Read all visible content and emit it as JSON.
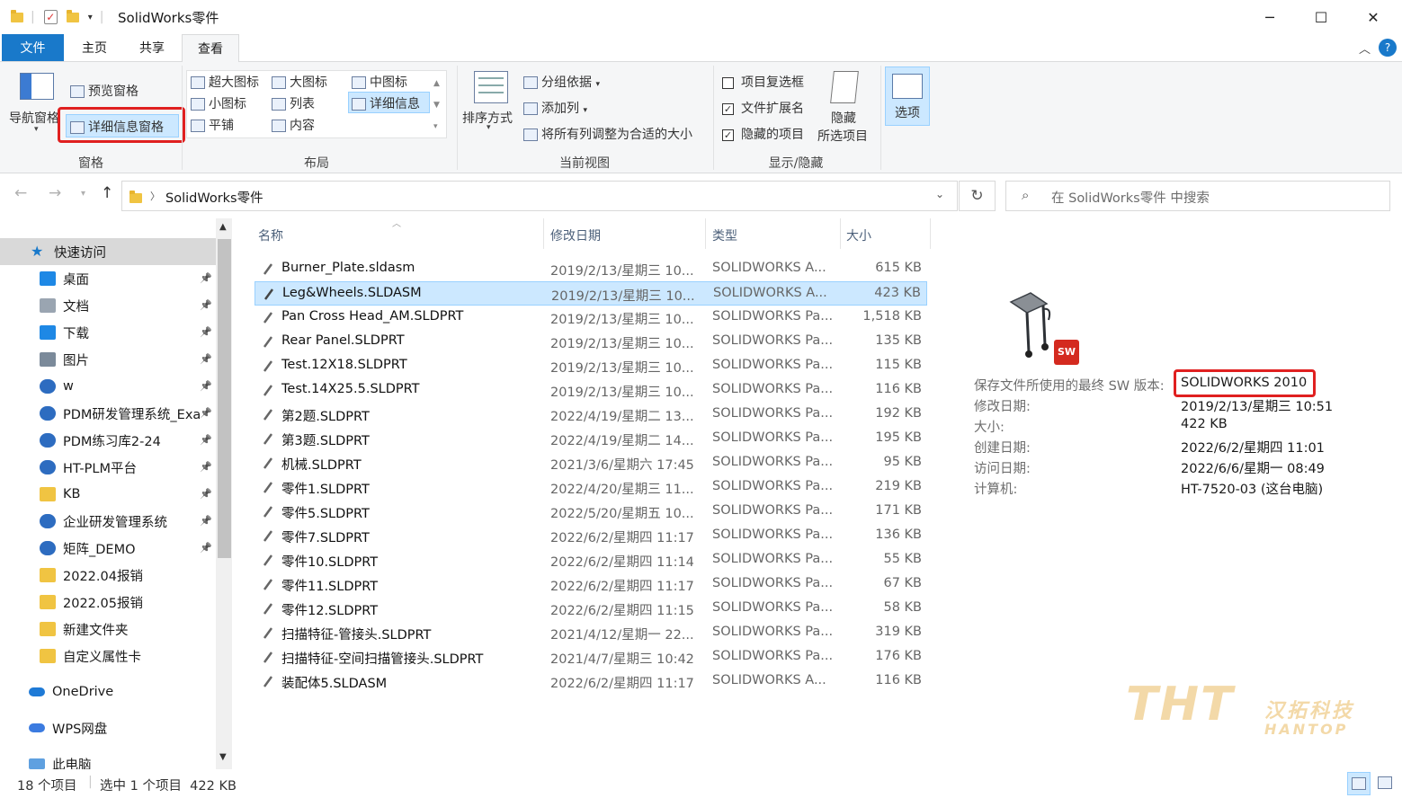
{
  "window": {
    "title": "SolidWorks零件",
    "controls": {
      "minimize": "─",
      "maximize": "☐",
      "close": "✕"
    }
  },
  "ribbon_tabs": [
    "文件",
    "主页",
    "共享",
    "查看"
  ],
  "ribbon": {
    "panes_group": {
      "nav_pane": "导航窗格",
      "preview_pane": "预览窗格",
      "details_pane": "详细信息窗格",
      "title": "窗格"
    },
    "layout_group": {
      "items": [
        "超大图标",
        "大图标",
        "中图标",
        "小图标",
        "列表",
        "详细信息",
        "平铺",
        "内容"
      ],
      "title": "布局"
    },
    "current_view_group": {
      "sort_by": "排序方式",
      "group_by": "分组依据",
      "add_column": "添加列",
      "fit_columns": "将所有列调整为合适的大小",
      "title": "当前视图"
    },
    "show_hide_group": {
      "item_checkboxes": "项目复选框",
      "file_extensions": "文件扩展名",
      "hidden_items": "隐藏的项目",
      "hide_selected_1": "隐藏",
      "hide_selected_2": "所选项目",
      "title": "显示/隐藏"
    },
    "options": "选项",
    "colors": {
      "file_tab": "#1979ca",
      "highlight": "#e02020"
    }
  },
  "address": {
    "path": "SolidWorks零件",
    "search_placeholder": "在 SolidWorks零件 中搜索"
  },
  "sidebar": {
    "quick_access": "快速访问",
    "items": [
      "桌面",
      "文档",
      "下载",
      "图片",
      "w",
      "PDM研发管理系统_Exa",
      "PDM练习库2-24",
      "HT-PLM平台",
      "KB",
      "企业研发管理系统",
      "矩阵_DEMO",
      "2022.04报销",
      "2022.05报销",
      "新建文件夹",
      "自定义属性卡"
    ],
    "onedrive": "OneDrive",
    "wps": "WPS网盘",
    "this_pc": "此电脑"
  },
  "columns": {
    "name": "名称",
    "date": "修改日期",
    "type": "类型",
    "size": "大小"
  },
  "files": [
    {
      "name": "Burner_Plate.sldasm",
      "date": "2019/2/13/星期三 10...",
      "type": "SOLIDWORKS A...",
      "size": "615 KB"
    },
    {
      "name": "Leg&Wheels.SLDASM",
      "date": "2019/2/13/星期三 10...",
      "type": "SOLIDWORKS A...",
      "size": "423 KB"
    },
    {
      "name": "Pan Cross Head_AM.SLDPRT",
      "date": "2019/2/13/星期三 10...",
      "type": "SOLIDWORKS Pa...",
      "size": "1,518 KB"
    },
    {
      "name": "Rear Panel.SLDPRT",
      "date": "2019/2/13/星期三 10...",
      "type": "SOLIDWORKS Pa...",
      "size": "135 KB"
    },
    {
      "name": "Test.12X18.SLDPRT",
      "date": "2019/2/13/星期三 10...",
      "type": "SOLIDWORKS Pa...",
      "size": "115 KB"
    },
    {
      "name": "Test.14X25.5.SLDPRT",
      "date": "2019/2/13/星期三 10...",
      "type": "SOLIDWORKS Pa...",
      "size": "116 KB"
    },
    {
      "name": "第2题.SLDPRT",
      "date": "2022/4/19/星期二 13...",
      "type": "SOLIDWORKS Pa...",
      "size": "192 KB"
    },
    {
      "name": "第3题.SLDPRT",
      "date": "2022/4/19/星期二 14...",
      "type": "SOLIDWORKS Pa...",
      "size": "195 KB"
    },
    {
      "name": "机械.SLDPRT",
      "date": "2021/3/6/星期六 17:45",
      "type": "SOLIDWORKS Pa...",
      "size": "95 KB"
    },
    {
      "name": "零件1.SLDPRT",
      "date": "2022/4/20/星期三 11...",
      "type": "SOLIDWORKS Pa...",
      "size": "219 KB"
    },
    {
      "name": "零件5.SLDPRT",
      "date": "2022/5/20/星期五 10...",
      "type": "SOLIDWORKS Pa...",
      "size": "171 KB"
    },
    {
      "name": "零件7.SLDPRT",
      "date": "2022/6/2/星期四 11:17",
      "type": "SOLIDWORKS Pa...",
      "size": "136 KB"
    },
    {
      "name": "零件10.SLDPRT",
      "date": "2022/6/2/星期四 11:14",
      "type": "SOLIDWORKS Pa...",
      "size": "55 KB"
    },
    {
      "name": "零件11.SLDPRT",
      "date": "2022/6/2/星期四 11:17",
      "type": "SOLIDWORKS Pa...",
      "size": "67 KB"
    },
    {
      "name": "零件12.SLDPRT",
      "date": "2022/6/2/星期四 11:15",
      "type": "SOLIDWORKS Pa...",
      "size": "58 KB"
    },
    {
      "name": "扫描特征-管接头.SLDPRT",
      "date": "2021/4/12/星期一 22...",
      "type": "SOLIDWORKS Pa...",
      "size": "319 KB"
    },
    {
      "name": "扫描特征-空间扫描管接头.SLDPRT",
      "date": "2021/4/7/星期三 10:42",
      "type": "SOLIDWORKS Pa...",
      "size": "176 KB"
    },
    {
      "name": "装配体5.SLDASM",
      "date": "2022/6/2/星期四 11:17",
      "type": "SOLIDWORKS A...",
      "size": "116 KB"
    }
  ],
  "details": {
    "rows": [
      {
        "k": "保存文件所使用的最终 SW 版本:",
        "v": "SOLIDWORKS 2010"
      },
      {
        "k": "修改日期:",
        "v": "2019/2/13/星期三 10:51"
      },
      {
        "k": "大小:",
        "v": "422 KB"
      },
      {
        "k": "创建日期:",
        "v": "2022/6/2/星期四 11:01"
      },
      {
        "k": "访问日期:",
        "v": "2022/6/6/星期一 08:49"
      },
      {
        "k": "计算机:",
        "v": "HT-7520-03 (这台电脑)"
      }
    ],
    "sw_badge": "SW"
  },
  "watermark": {
    "logo": "THT",
    "cn": "汉拓科技",
    "en": "HANTOP"
  },
  "status": {
    "count": "18 个项目",
    "selected": "选中 1 个项目  422 KB"
  }
}
